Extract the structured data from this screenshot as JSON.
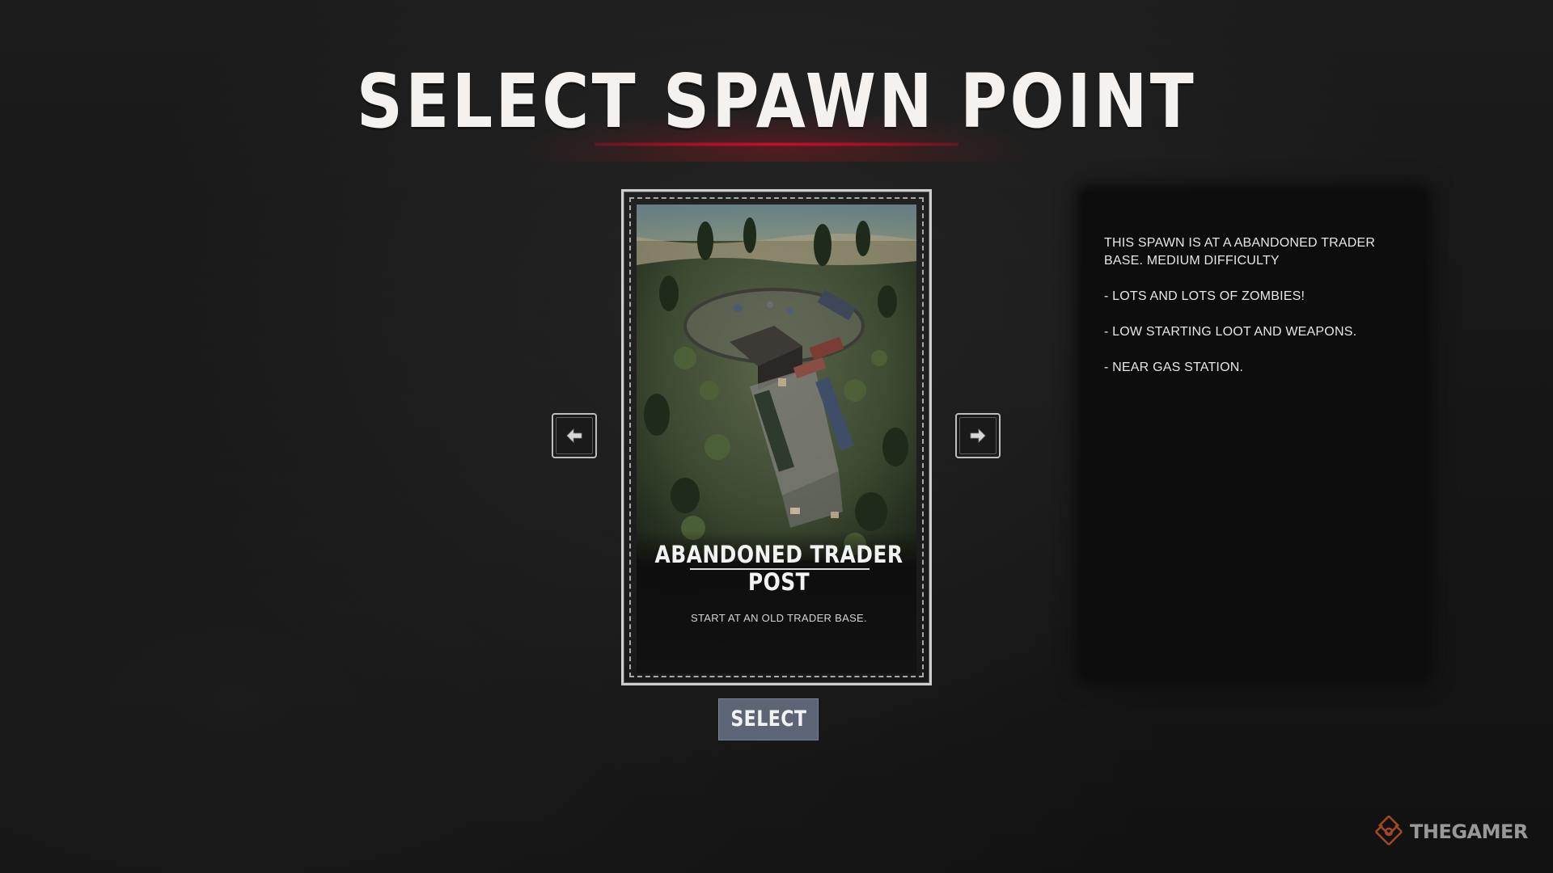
{
  "screen": {
    "title": "SELECT SPAWN POINT"
  },
  "card": {
    "name": "ABANDONED TRADER POST",
    "description": "START AT AN OLD TRADER BASE.",
    "image_icon": "aerial-base-image"
  },
  "navigation": {
    "prev_icon": "arrow-left-icon",
    "next_icon": "arrow-right-icon"
  },
  "actions": {
    "select_label": "SELECT"
  },
  "info_panel": {
    "lines": [
      "THIS SPAWN IS AT A ABANDONED TRADER BASE. MEDIUM DIFFICULTY",
      "- LOTS AND LOTS OF ZOMBIES!",
      "- LOW STARTING LOOT AND WEAPONS.",
      "- NEAR GAS STATION."
    ]
  },
  "watermark": {
    "text": "THEGAMER",
    "logo_icon": "thegamer-logo-icon"
  },
  "colors": {
    "accent_red": "#d0192a",
    "select_button": "#5b6576",
    "background": "#151515"
  }
}
